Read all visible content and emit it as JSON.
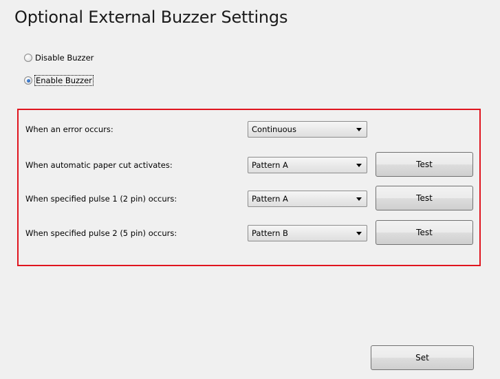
{
  "title": "Optional External Buzzer Settings",
  "buzzer_mode": {
    "options": [
      "Disable Buzzer",
      "Enable Buzzer"
    ],
    "selected": "Enable Buzzer"
  },
  "rows": [
    {
      "label": "When an error occurs:",
      "value": "Continuous",
      "has_test": false
    },
    {
      "label": "When automatic paper cut activates:",
      "value": "Pattern A",
      "has_test": true,
      "test_label": "Test"
    },
    {
      "label": "When specified pulse 1 (2 pin) occurs:",
      "value": "Pattern A",
      "has_test": true,
      "test_label": "Test"
    },
    {
      "label": "When specified pulse 2 (5 pin) occurs:",
      "value": "Pattern B",
      "has_test": true,
      "test_label": "Test"
    }
  ],
  "set_label": "Set",
  "colors": {
    "highlight_border": "#e0141e",
    "background": "#f0f0f0"
  }
}
